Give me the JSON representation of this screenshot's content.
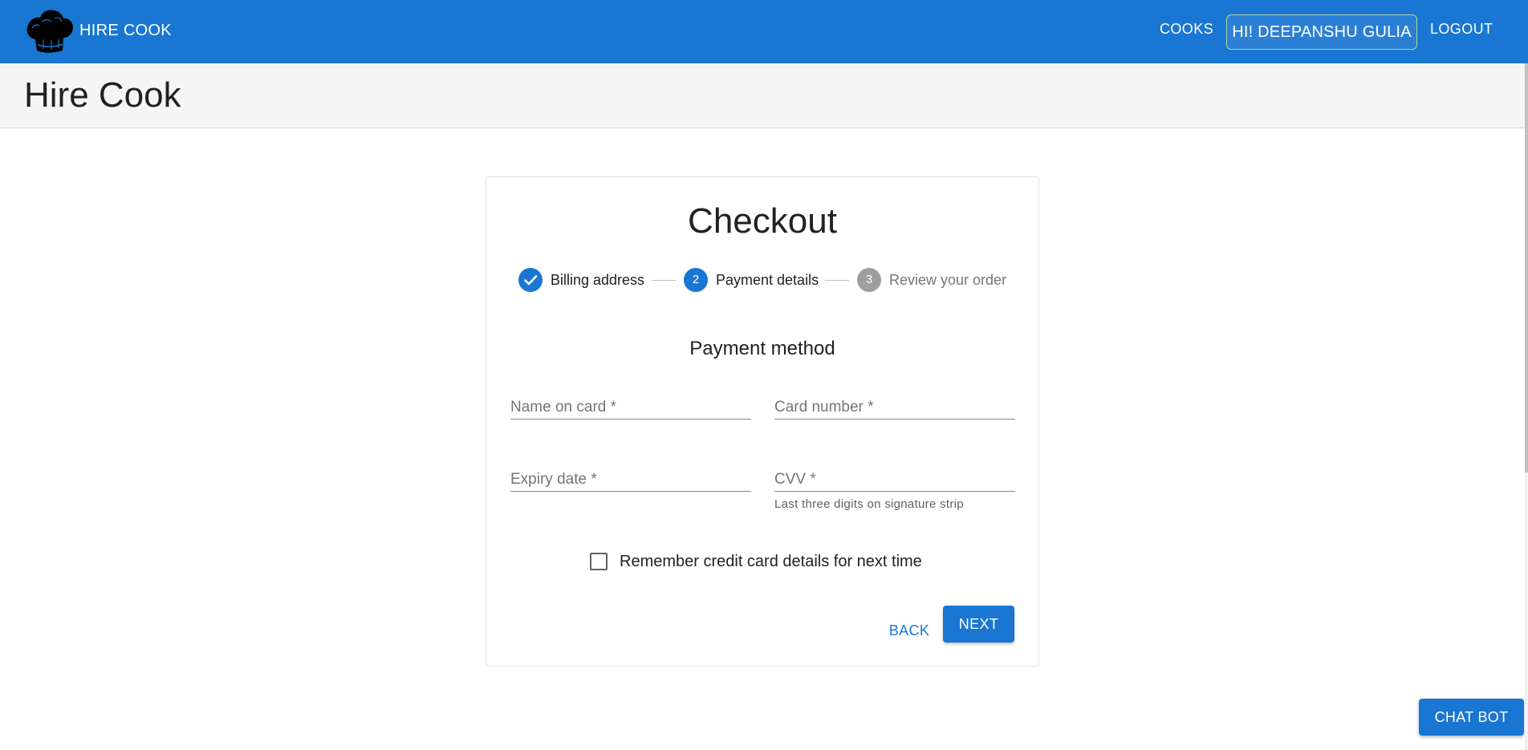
{
  "appbar": {
    "brand": "HIRE COOK",
    "logo_icon": "chef-hat-icon",
    "nav": {
      "cooks": "COOKS",
      "user": "HI! DEEPANSHU GULIA",
      "logout": "LOGOUT"
    },
    "color": "#1976d2"
  },
  "page": {
    "title": "Hire Cook"
  },
  "checkout": {
    "title": "Checkout",
    "steps": [
      {
        "label": "Billing address",
        "state": "completed",
        "icon": "check-icon"
      },
      {
        "label": "Payment details",
        "state": "active",
        "number": "2"
      },
      {
        "label": "Review your order",
        "state": "pending",
        "number": "3"
      }
    ],
    "section_title": "Payment method",
    "fields": {
      "name_on_card": {
        "placeholder": "Name on card *",
        "value": ""
      },
      "card_number": {
        "placeholder": "Card number *",
        "value": ""
      },
      "expiry_date": {
        "placeholder": "Expiry date *",
        "value": ""
      },
      "cvv": {
        "placeholder": "CVV *",
        "value": "",
        "helper": "Last three digits on signature strip"
      }
    },
    "remember": {
      "label": "Remember credit card details for next time",
      "checked": false
    },
    "buttons": {
      "back": "BACK",
      "next": "NEXT"
    }
  },
  "chat_bot": {
    "label": "CHAT BOT"
  }
}
